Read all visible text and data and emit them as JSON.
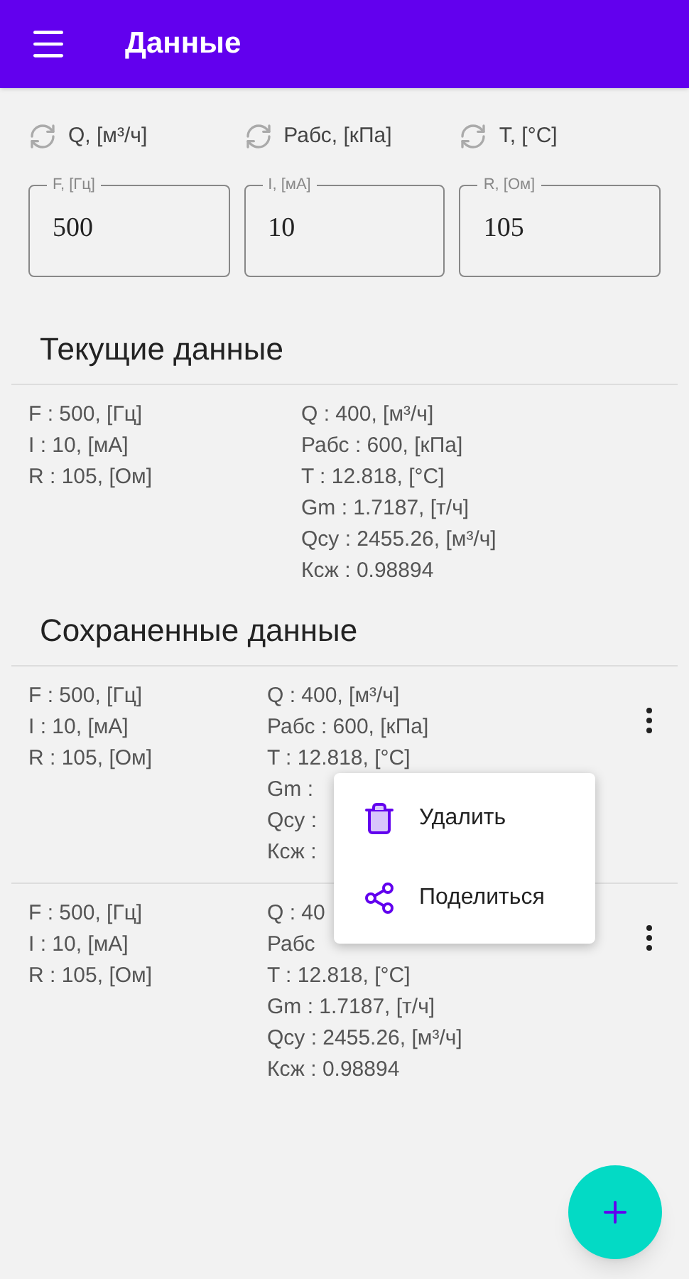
{
  "app_bar": {
    "title": "Данные"
  },
  "unit_selectors": [
    {
      "label": "Q, [м³/ч]"
    },
    {
      "label": "Рабс, [кПа]"
    },
    {
      "label": "T, [°C]"
    }
  ],
  "inputs": [
    {
      "label": "F, [Гц]",
      "value": "500"
    },
    {
      "label": "I, [мА]",
      "value": "10"
    },
    {
      "label": "R, [Ом]",
      "value": "105"
    }
  ],
  "current": {
    "title": "Текущие данные",
    "inputs": [
      "F : 500, [Гц]",
      "I : 10, [мА]",
      "R : 105, [Ом]"
    ],
    "results": [
      "Q : 400, [м³/ч]",
      "Рабс : 600, [кПа]",
      "T : 12.818, [°C]",
      "Gm : 1.7187, [т/ч]",
      "Qcy : 2455.26, [м³/ч]",
      "Ксж : 0.98894"
    ]
  },
  "saved": {
    "title": "Сохраненные данные",
    "records": [
      {
        "inputs": [
          "F : 500, [Гц]",
          "I : 10, [мА]",
          "R : 105, [Ом]"
        ],
        "results": [
          "Q : 400, [м³/ч]",
          "Рабс : 600, [кПа]",
          "T : 12.818, [°C]",
          "Gm :",
          "Qcy :",
          "Ксж :"
        ],
        "context_menu": {
          "items": [
            {
              "label": "Удалить",
              "kind": "delete"
            },
            {
              "label": "Поделиться",
              "kind": "share"
            }
          ]
        }
      },
      {
        "inputs": [
          "F : 500, [Гц]",
          "I : 10, [мА]",
          "R : 105, [Ом]"
        ],
        "results": [
          "Q : 40",
          "Рабс",
          "T : 12.818, [°C]",
          "Gm : 1.7187, [т/ч]",
          "Qcy : 2455.26, [м³/ч]",
          "Ксж : 0.98894"
        ]
      }
    ]
  }
}
